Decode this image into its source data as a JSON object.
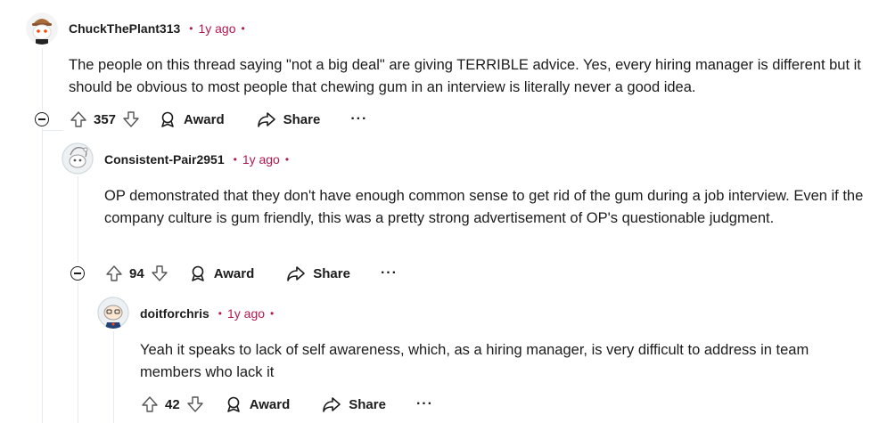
{
  "comments": [
    {
      "username": "ChuckThePlant313",
      "separator": "•",
      "age": "1y ago",
      "body": "The people on this thread saying \"not a big deal\" are giving TERRIBLE advice. Yes, every hiring manager is different but it should be obvious to most people that chewing gum in an interview is literally never a good idea.",
      "score": "357",
      "award_label": "Award",
      "share_label": "Share",
      "more_label": "···"
    },
    {
      "username": "Consistent-Pair2951",
      "separator": "•",
      "age": "1y ago",
      "body": "OP demonstrated that they don't have enough common sense to get rid of the gum during a job interview. Even if the company culture is gum friendly, this was a pretty strong advertisement of OP's questionable judgment.",
      "score": "94",
      "award_label": "Award",
      "share_label": "Share",
      "more_label": "···"
    },
    {
      "username": "doitforchris",
      "separator": "•",
      "age": "1y ago",
      "body": "Yeah it speaks to lack of self awareness, which, as a hiring manager, is very difficult to address in team members who lack it",
      "score": "42",
      "award_label": "Award",
      "share_label": "Share",
      "more_label": "···"
    }
  ],
  "colors": {
    "accent": "#b4184f",
    "thread_line": "#e5ebee",
    "text": "#1c1c1c"
  },
  "icons": [
    "snoo-avatar-icon",
    "collapse-icon",
    "upvote-icon",
    "downvote-icon",
    "award-icon",
    "share-icon",
    "more-icon"
  ]
}
